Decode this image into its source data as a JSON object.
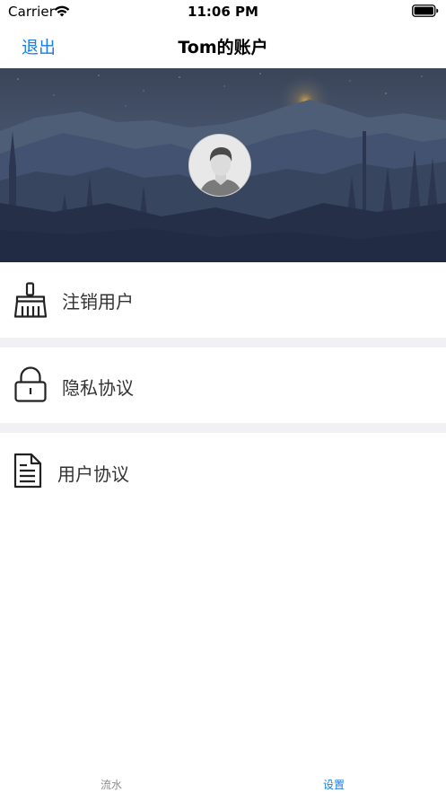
{
  "status_bar": {
    "carrier": "Carrier",
    "time": "11:06 PM",
    "icons": [
      "wifi-icon",
      "battery-icon"
    ]
  },
  "nav": {
    "back_label": "退出",
    "title": "Tom的账户"
  },
  "banner": {
    "image": "mountain-night-landscape",
    "avatar_icon": "default-user-avatar"
  },
  "menu": {
    "items": [
      {
        "label": "注销用户",
        "icon": "broom-icon"
      },
      {
        "label": "隐私协议",
        "icon": "lock-icon"
      },
      {
        "label": "用户协议",
        "icon": "document-icon"
      }
    ]
  },
  "tab_bar": {
    "tabs": [
      {
        "label": "流水",
        "selected": false
      },
      {
        "label": "设置",
        "selected": true
      }
    ]
  },
  "colors": {
    "accent": "#1a7ee6",
    "separator": "#f0f0f5",
    "inactive_tab": "#8e8e8e",
    "banner_dark": "#2b3553"
  }
}
